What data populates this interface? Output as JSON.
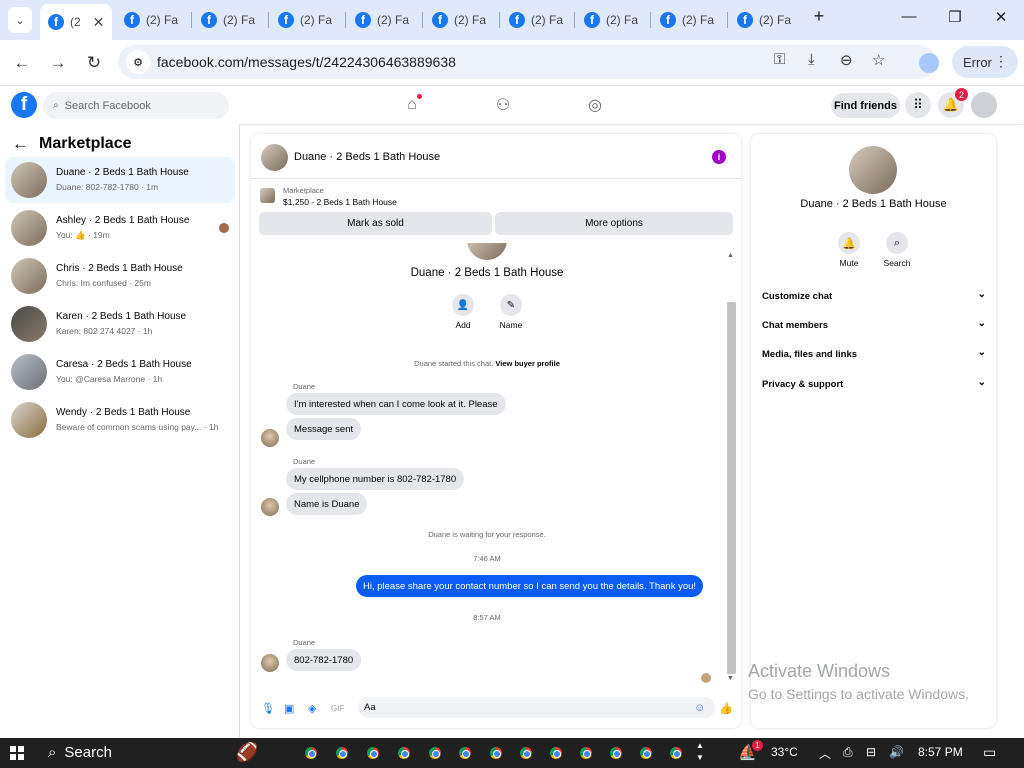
{
  "browser": {
    "active_tab_label": "(2",
    "tab_label": "(2) Fa",
    "url": "facebook.com/messages/t/24224306463889638",
    "profile_status": "Error"
  },
  "facebook": {
    "search_placeholder": "Search Facebook",
    "find_friends": "Find friends",
    "notification_count": "2"
  },
  "sidebar": {
    "title": "Marketplace",
    "conversations": [
      {
        "title": "Duane · 2 Beds 1 Bath House",
        "snippet": "Duane: 802-782-1780 · 1m"
      },
      {
        "title": "Ashley · 2 Beds 1 Bath House",
        "snippet": "You: 👍 · 19m"
      },
      {
        "title": "Chris · 2 Beds 1 Bath House",
        "snippet": "Chris: Im confused · 25m"
      },
      {
        "title": "Karen · 2 Beds 1 Bath House",
        "snippet": "Karen: 802 274 4027 · 1h"
      },
      {
        "title": "Caresa · 2 Beds 1 Bath House",
        "snippet": "You: @Caresa Marrone · 1h"
      },
      {
        "title": "Wendy · 2 Beds 1 Bath House",
        "snippet": "Beware of common scams using pay... · 1h"
      }
    ]
  },
  "chat": {
    "header_name": "Duane · 2 Beds 1 Bath House",
    "marketplace_label": "Marketplace",
    "listing": "$1,250 - 2 Beds 1 Bath House",
    "mark_sold": "Mark as sold",
    "more_options": "More options",
    "contact_name": "Duane · 2 Beds 1 Bath House",
    "add_label": "Add",
    "name_label": "Name",
    "started_text": "Duane started this chat.",
    "view_profile": "View buyer profile",
    "sender": "Duane",
    "msg1": "I'm interested when can I come look at it. Please",
    "msg2": "Message sent",
    "msg3": "My cellphone number is 802-782-1780",
    "msg4": "Name is Duane",
    "waiting": "Duane is waiting for your response.",
    "time1": "7:46 AM",
    "outgoing": "Hi, please share your contact number so I can send you the details. Thank you!",
    "time2": "8:57 AM",
    "msg5": "802-782-1780",
    "composer_placeholder": "Aa"
  },
  "details": {
    "name": "Duane · 2 Beds 1 Bath House",
    "mute": "Mute",
    "search": "Search",
    "options": [
      "Customize chat",
      "Chat members",
      "Media, files and links",
      "Privacy & support"
    ]
  },
  "watermark": {
    "line1": "Activate Windows",
    "line2": "Go to Settings to activate Windows."
  },
  "taskbar": {
    "search": "Search",
    "weather": "33°C",
    "time": "8:57 PM",
    "weather_badge": "1"
  }
}
